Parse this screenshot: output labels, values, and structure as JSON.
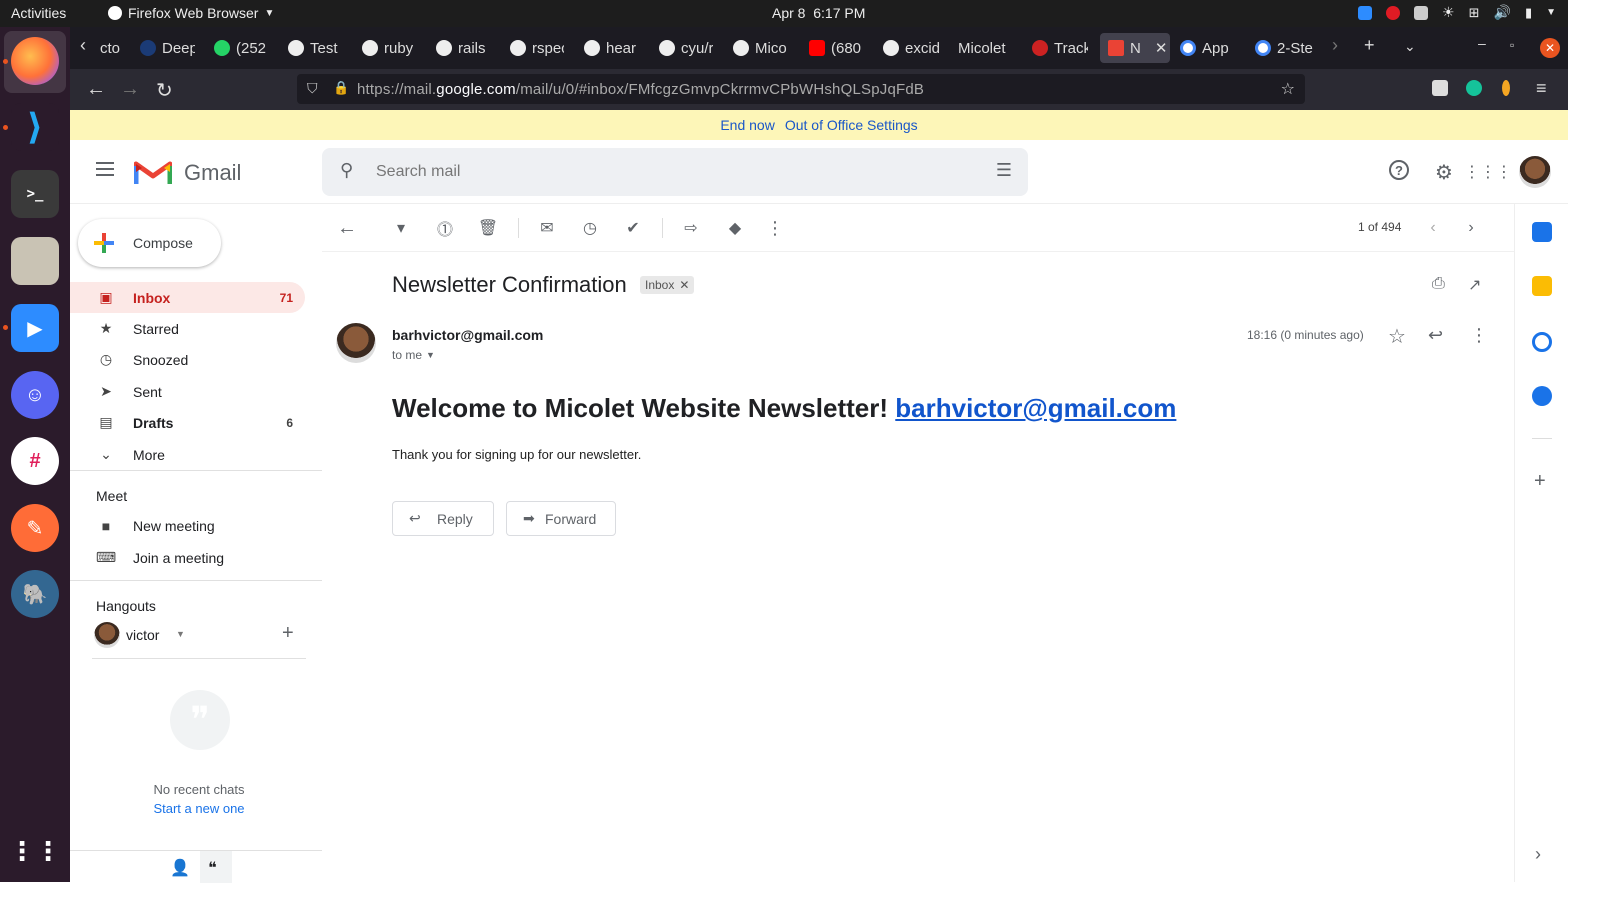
{
  "system_bar": {
    "activities": "Activities",
    "app_name": "Firefox Web Browser",
    "date": "Apr 8",
    "time": "6:17 PM"
  },
  "browser": {
    "tabs": [
      {
        "label": "cto",
        "icon": "page-icon"
      },
      {
        "label": "Deep",
        "icon": "deepl-icon"
      },
      {
        "label": "(252",
        "icon": "whatsapp-icon"
      },
      {
        "label": "Test",
        "icon": "github-icon"
      },
      {
        "label": "ruby",
        "icon": "github-icon"
      },
      {
        "label": "rails",
        "icon": "github-icon"
      },
      {
        "label": "rspec",
        "icon": "github-icon"
      },
      {
        "label": "hear",
        "icon": "github-icon"
      },
      {
        "label": "cyu/r",
        "icon": "github-icon"
      },
      {
        "label": "Mico",
        "icon": "github-icon"
      },
      {
        "label": "(680",
        "icon": "youtube-icon"
      },
      {
        "label": "excid",
        "icon": "github-icon"
      },
      {
        "label": "Micolet",
        "icon": "none"
      },
      {
        "label": "Track",
        "icon": "target-icon"
      },
      {
        "label": "N",
        "icon": "gmail-icon"
      },
      {
        "label": "App",
        "icon": "google-icon"
      },
      {
        "label": "2-Ste",
        "icon": "google-icon"
      }
    ],
    "url_prefix": "https://mail.",
    "url_domain": "google.com",
    "url_path": "/mail/u/0/#inbox/FMfcgzGmvpCkrrmvCPbWHshQLSpJqFdB"
  },
  "banner": {
    "end_now": "End now",
    "settings": "Out of Office Settings"
  },
  "gmail": {
    "brand": "Gmail",
    "search_placeholder": "Search mail",
    "compose": "Compose",
    "nav": [
      {
        "label": "Inbox",
        "count": "71"
      },
      {
        "label": "Starred",
        "count": ""
      },
      {
        "label": "Snoozed",
        "count": ""
      },
      {
        "label": "Sent",
        "count": ""
      },
      {
        "label": "Drafts",
        "count": "6"
      },
      {
        "label": "More",
        "count": ""
      }
    ],
    "meet": {
      "heading": "Meet",
      "new_meeting": "New meeting",
      "join_meeting": "Join a meeting"
    },
    "hangouts": {
      "heading": "Hangouts",
      "user": "victor",
      "no_chats": "No recent chats",
      "start_new": "Start a new one"
    },
    "pager": "1 of 494"
  },
  "message": {
    "subject": "Newsletter Confirmation",
    "label_chip": "Inbox",
    "sender": "barhvictor@gmail.com",
    "to": "to me",
    "time": "18:16 (0 minutes ago)",
    "heading_text": "Welcome to Micolet Website Newsletter!",
    "heading_link": "barhvictor@gmail.com",
    "body": "Thank you for signing up for our newsletter.",
    "reply": "Reply",
    "forward": "Forward"
  },
  "colors": {
    "banner_bg": "#fdf6b8",
    "inbox_active_bg": "#fce8e6",
    "inbox_active_text": "#c5221f",
    "link": "#1155cc",
    "dock_bg": "#2b1b2b"
  }
}
